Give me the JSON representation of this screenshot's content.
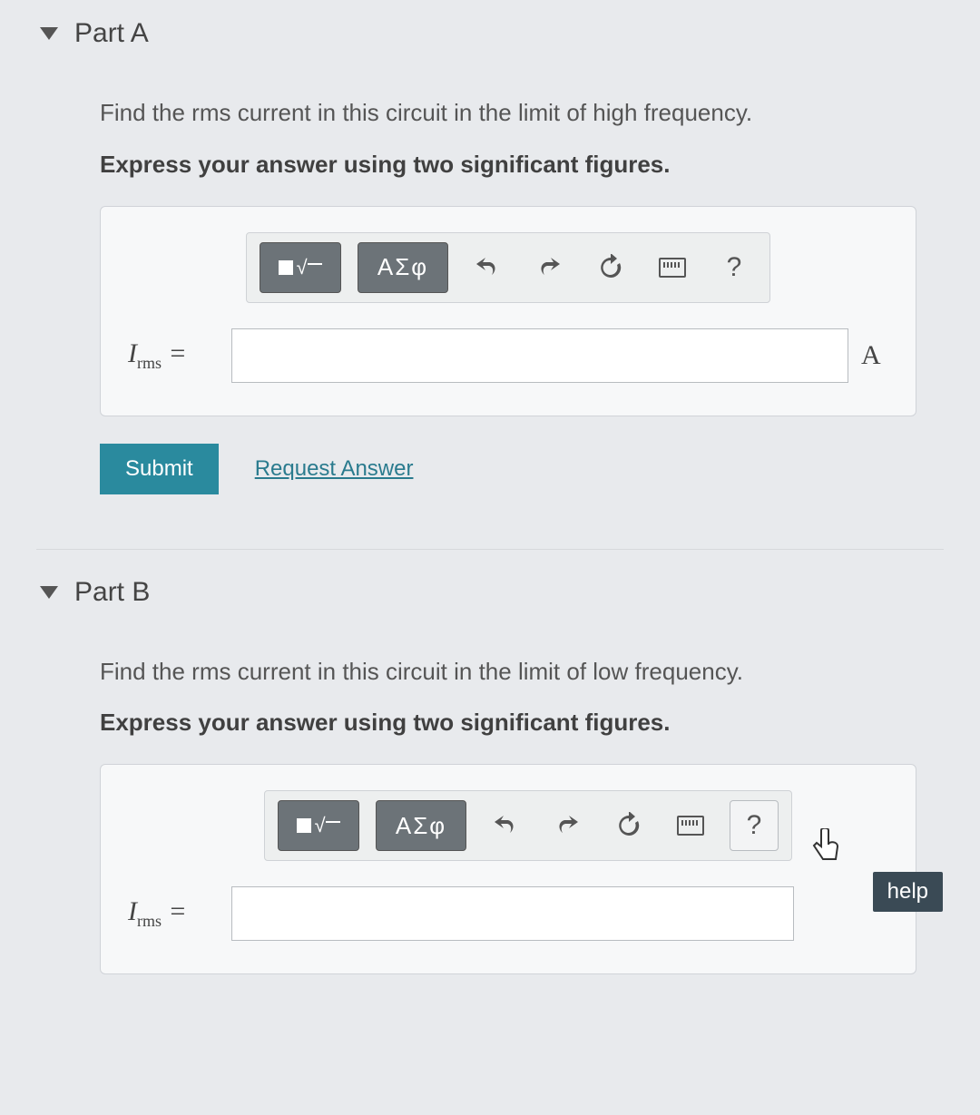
{
  "partA": {
    "title": "Part A",
    "prompt_line1": "Find the rms current in this circuit in the limit of high frequency.",
    "prompt_line2": "Express your answer using two significant figures.",
    "toolbar": {
      "symbols_label": "ΑΣφ",
      "help_label": "?"
    },
    "variable_html": "I<sub>rms</sub> =",
    "variable_text": "Irms =",
    "answer_value": "",
    "unit": "A",
    "submit_label": "Submit",
    "request_answer_label": "Request Answer"
  },
  "partB": {
    "title": "Part B",
    "prompt_line1": "Find the rms current in this circuit in the limit of low frequency.",
    "prompt_line2": "Express your answer using two significant figures.",
    "toolbar": {
      "symbols_label": "ΑΣφ",
      "help_label": "?"
    },
    "variable_html": "I<sub>rms</sub> =",
    "variable_text": "Irms =",
    "answer_value": "",
    "unit": "",
    "tooltip": "help"
  }
}
